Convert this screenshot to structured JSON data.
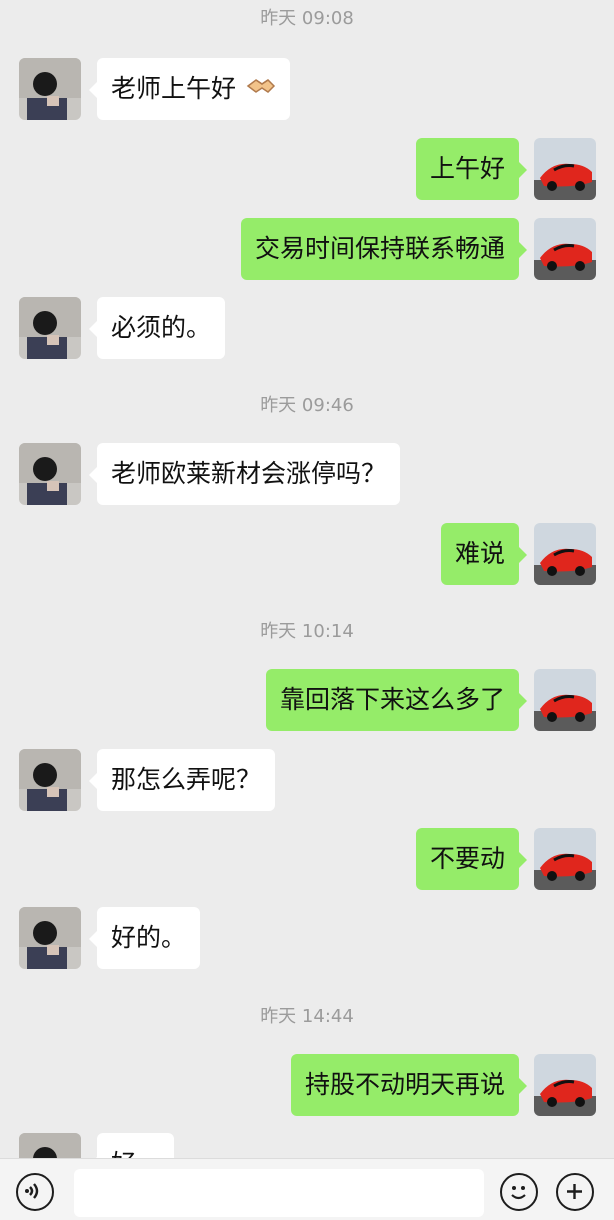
{
  "colors": {
    "background": "#ececec",
    "bubble_self": "#95ec69",
    "bubble_other": "#ffffff",
    "timestamp_text": "#9b9b9b"
  },
  "timestamps": [
    "昨天 09:08",
    "昨天 09:46",
    "昨天 10:14",
    "昨天 14:44"
  ],
  "messages": [
    {
      "side": "left",
      "text": "老师上午好",
      "emoji": "handshake"
    },
    {
      "side": "right",
      "text": "上午好"
    },
    {
      "side": "right",
      "text": "交易时间保持联系畅通"
    },
    {
      "side": "left",
      "text": "必须的。"
    },
    {
      "side": "left",
      "text": "老师欧莱新材会涨停吗？"
    },
    {
      "side": "right",
      "text": "难说"
    },
    {
      "side": "right",
      "text": "靠回落下来这么多了"
    },
    {
      "side": "left",
      "text": "那怎么弄呢？"
    },
    {
      "side": "right",
      "text": "不要动"
    },
    {
      "side": "left",
      "text": "好的。"
    },
    {
      "side": "right",
      "text": "持股不动明天再说"
    },
    {
      "side": "left",
      "text": "好..."
    }
  ],
  "bottom_bar": {
    "voice_icon": "voice-icon",
    "emoji_icon": "emoji-icon",
    "plus_icon": "plus-icon"
  }
}
